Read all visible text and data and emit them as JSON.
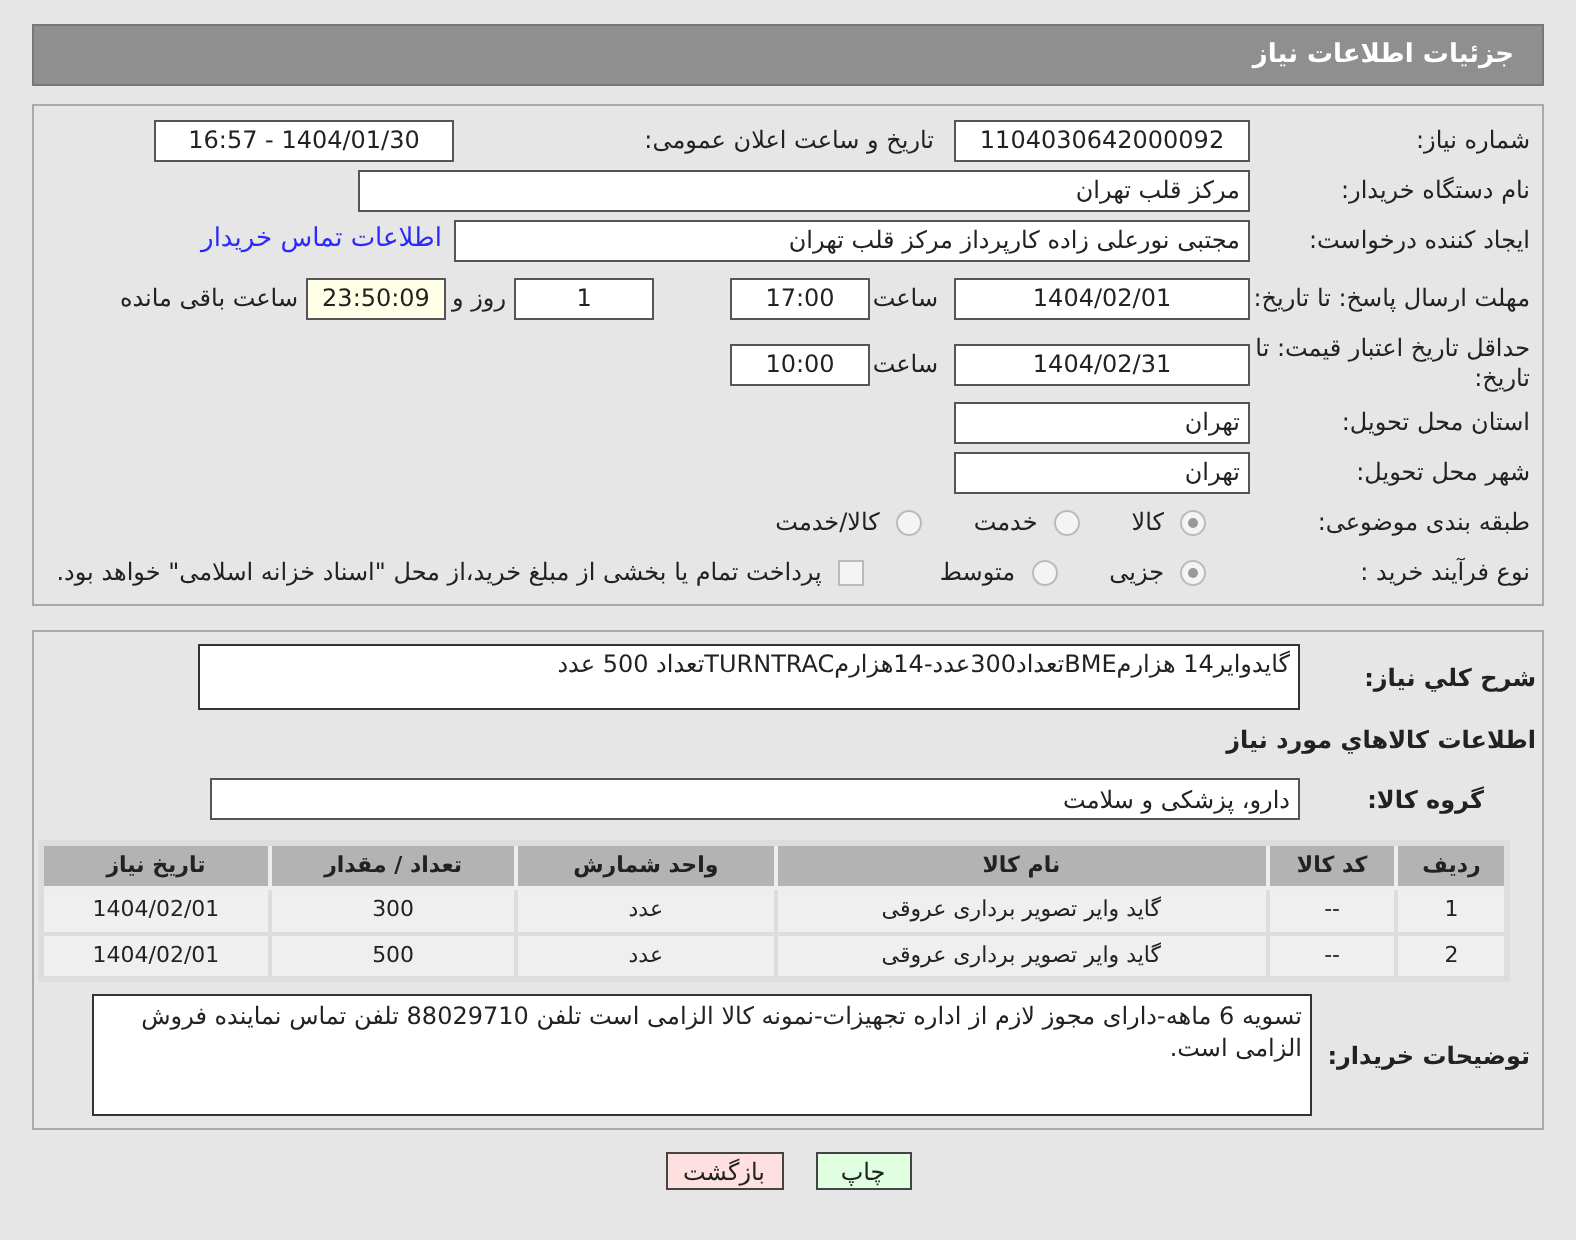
{
  "header": {
    "title": "جزئیات اطلاعات نیاز"
  },
  "need_number": {
    "label": "شماره نیاز:",
    "value": "1104030642000092"
  },
  "announce": {
    "label": "تاریخ و ساعت اعلان عمومی:",
    "value": "1404/01/30 - 16:57"
  },
  "buyer_org": {
    "label": "نام دستگاه خریدار:",
    "value": "مرکز قلب تهران"
  },
  "requester": {
    "label": "ایجاد کننده درخواست:",
    "value": "مجتبی نورعلی زاده کارپرداز مرکز قلب تهران",
    "link": "اطلاعات تماس خریدار"
  },
  "reply_deadline": {
    "label": "مهلت ارسال پاسخ: تا تاریخ:",
    "date": "1404/02/01",
    "time_label": "ساعت",
    "time": "17:00",
    "days": "1",
    "days_label": "روز و",
    "remaining": "23:50:09",
    "remaining_label": "ساعت باقی مانده"
  },
  "price_validity": {
    "label": "حداقل تاریخ اعتبار قیمت: تا تاریخ:",
    "date": "1404/02/31",
    "time_label": "ساعت",
    "time": "10:00"
  },
  "province": {
    "label": "استان محل تحویل:",
    "value": "تهران"
  },
  "city": {
    "label": "شهر محل تحویل:",
    "value": "تهران"
  },
  "category": {
    "label": "طبقه بندی موضوعی:",
    "options": [
      {
        "label": "کالا",
        "selected": true
      },
      {
        "label": "خدمت",
        "selected": false
      },
      {
        "label": "کالا/خدمت",
        "selected": false
      }
    ]
  },
  "process": {
    "label": "نوع فرآیند خرید :",
    "options": [
      {
        "label": "جزیی",
        "selected": true
      },
      {
        "label": "متوسط",
        "selected": false
      }
    ],
    "payment": {
      "label": "پرداخت تمام یا بخشی از مبلغ خرید،از محل \"اسناد خزانه اسلامی\" خواهد بود.",
      "checked": false
    }
  },
  "description": {
    "label": "شرح کلي نياز:",
    "value": "گایدوایر14 هزارمBMEتعداد300عدد-14هزارمTURNTRACتعداد 500 عدد"
  },
  "goods_heading": "اطلاعات كالاهاي مورد نياز",
  "goods_group": {
    "label": "گروه کالا:",
    "value": "دارو، پزشکی و سلامت"
  },
  "table": {
    "columns": [
      "ردیف",
      "کد کالا",
      "نام کالا",
      "واحد شمارش",
      "تعداد / مقدار",
      "تاریخ نیاز"
    ],
    "rows": [
      [
        "1",
        "--",
        "گاید وایر تصویر برداری عروقی",
        "عدد",
        "300",
        "1404/02/01"
      ],
      [
        "2",
        "--",
        "گاید وایر تصویر برداری عروقی",
        "عدد",
        "500",
        "1404/02/01"
      ]
    ]
  },
  "buyer_notes": {
    "label": "توضیحات خریدار:",
    "value": "تسویه 6 ماهه-دارای مجوز لازم از اداره تجهیزات-نمونه کالا الزامی است تلفن 88029710 تلفن تماس نماینده فروش الزامی است."
  },
  "buttons": [
    {
      "label": "چاپ",
      "kind": "print"
    },
    {
      "label": "بازگشت",
      "kind": "back"
    }
  ]
}
